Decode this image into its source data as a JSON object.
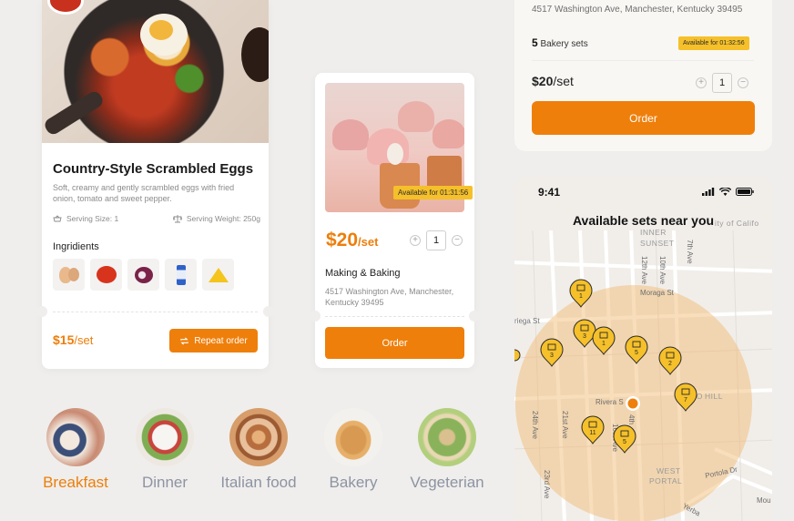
{
  "recipe": {
    "title": "Country-Style Scrambled Eggs",
    "description": "Soft, creamy and gently scrambled eggs with fried onion, tomato and sweet pepper.",
    "serving_size": "Serving Size: 1",
    "serving_weight": "Serving Weight: 250g",
    "ingredients_label": "Ingridients",
    "ingredients": [
      "egg-icon",
      "tomato-icon",
      "onion-icon",
      "milk-icon",
      "cheese-icon"
    ],
    "price": "$15",
    "unit": "/set",
    "repeat_label": "Repeat order"
  },
  "bakery": {
    "availability": "Available for 01:31:56",
    "price": "$20",
    "unit": "/set",
    "quantity": "1",
    "name": "Making & Baking",
    "address": "4517 Washington Ave, Manchester, Kentucky 39495",
    "order_label": "Order"
  },
  "set_card": {
    "address": "4517 Washington Ave, Manchester, Kentucky 39495",
    "count": "5",
    "count_label": "Bakery sets",
    "availability": "Available for 01:32:56",
    "price": "$20",
    "unit": "/set",
    "quantity": "1",
    "order_label": "Order"
  },
  "map": {
    "time": "9:41",
    "title": "Available sets near you",
    "streets": [
      "INNER",
      "SUNSET",
      "12th Ave",
      "10th Ave",
      "7th Ave",
      "Moraga St",
      "riega St",
      "Rivera S",
      "24th Ave",
      "21st Ave",
      "4th",
      "16th Ave",
      "23rd Ave",
      "Portola Dr",
      "Yerba",
      "Mou",
      "WEST",
      "PORTAL",
      "FO",
      "HILL",
      "ity of Califo"
    ],
    "pins": [
      "1",
      "3",
      "1",
      "5",
      "3",
      "2",
      "7",
      "11",
      "5"
    ]
  },
  "categories": [
    {
      "label": "Breakfast",
      "active": true
    },
    {
      "label": "Dinner",
      "active": false
    },
    {
      "label": "Italian food",
      "active": false
    },
    {
      "label": "Bakery",
      "active": false
    },
    {
      "label": "Vegeterian",
      "active": false
    }
  ],
  "colors": {
    "accent": "#ef7f0b",
    "tag": "#f5c02a",
    "muted": "#8d93a2"
  }
}
